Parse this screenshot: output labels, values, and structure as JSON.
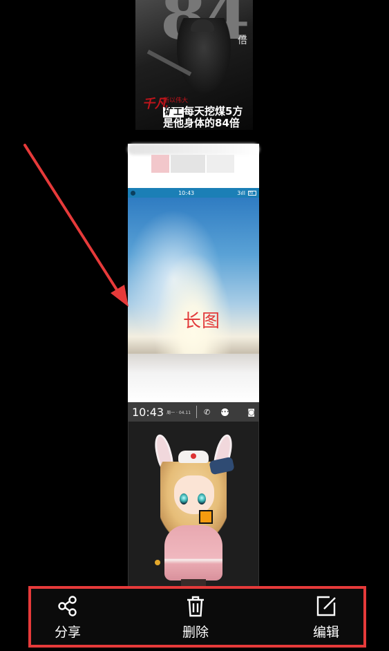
{
  "poster": {
    "big_number": "84",
    "bei": "倍",
    "logo": "千凡",
    "tagline": "所以伟大",
    "tag": "矿工",
    "line1_rest": "每天挖煤5方",
    "line2": "是他身体的84倍"
  },
  "phone_screenshot": {
    "status_time": "10:43",
    "status_signal": "3ıll",
    "status_battery": "70",
    "overlay_label": "长图",
    "lock_time": "10:43",
    "lock_date": "周一 · 04.11"
  },
  "toolbar": {
    "share_label": "分享",
    "delete_label": "删除",
    "edit_label": "编辑"
  },
  "colors": {
    "highlight_border": "#e63a3a",
    "arrow": "#e63a3a",
    "label_red": "#e23b3b",
    "background": "#000000"
  },
  "icons": [
    "share-icon",
    "trash-icon",
    "edit-icon",
    "phone-icon",
    "message-icon",
    "camera-icon"
  ]
}
